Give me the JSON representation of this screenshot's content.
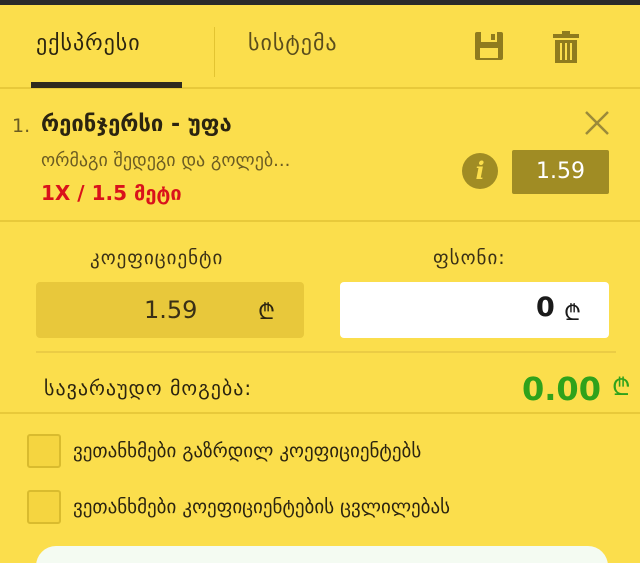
{
  "tabs": {
    "express": "ექსპრესი",
    "system": "სისტემა"
  },
  "icons": {
    "save": "floppy-disk-icon",
    "trash": "trash-icon",
    "close": "close-icon",
    "info": "info-icon",
    "currency": "lari-icon"
  },
  "bet": {
    "number": "1.",
    "match": "რეინჯერსი - უფა",
    "market": "ორმაგი შედეგი და გოლებ...",
    "selection": "1X / 1.5 მეტი",
    "odds": "1.59"
  },
  "fields": {
    "coef_label": "კოეფიციენტი",
    "coef_value": "1.59",
    "stake_label": "ფსონი:",
    "stake_value": "0",
    "currency_symbol": "₾"
  },
  "winnings": {
    "label": "სავარაუდო მოგება:",
    "value": "0.00",
    "currency_symbol": "₾"
  },
  "options": {
    "accept_increased": "ვეთანხმები გაზრდილ კოეფიციენტებს",
    "accept_changes": "ვეთანხმები კოეფიციენტების ცვლილებას"
  },
  "colors": {
    "background": "#fbde4c",
    "odds_badge": "#a08c24",
    "selection_red": "#d9121b",
    "winnings_green": "#2fa21b"
  }
}
